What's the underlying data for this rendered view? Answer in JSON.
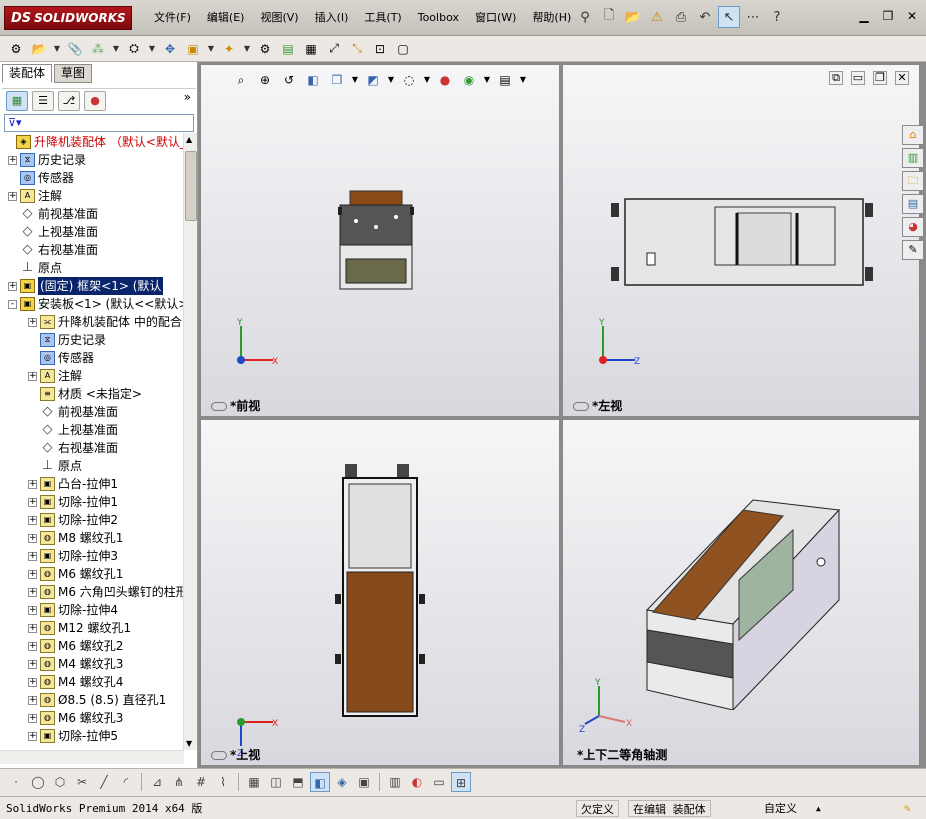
{
  "app": {
    "name": "SOLIDWORKS",
    "logo_prefix": "DS",
    "brand_color": "#a0141a"
  },
  "menu": [
    "文件(F)",
    "编辑(E)",
    "视图(V)",
    "插入(I)",
    "工具(T)",
    "Toolbox",
    "窗口(W)",
    "帮助(H)"
  ],
  "quick_tools": [
    "pin-icon",
    "new-doc-icon",
    "open-icon",
    "rebuild-warning-icon",
    "print-icon",
    "undo-icon",
    "select-icon",
    "options-icon",
    "help-icon"
  ],
  "window_controls": [
    "minimize-icon",
    "restore-icon",
    "close-icon"
  ],
  "toolbar2": [
    "edit-component-icon",
    "insert-component-icon",
    "mate-icon",
    "pattern-icon",
    "smart-fastener-icon",
    "move-component-icon",
    "show-hidden-icon",
    "assembly-features-icon",
    "reference-geometry-icon",
    "new-motion-study-icon",
    "bill-of-materials-icon",
    "exploded-view-icon",
    "explode-line-icon",
    "interference-icon",
    "instant3d-icon"
  ],
  "left_panel": {
    "tabs": [
      "装配体",
      "草图"
    ],
    "manager_icons": [
      "featuremanager-icon",
      "propertymanager-icon",
      "configurationmanager-icon",
      "appearance-icon"
    ],
    "tree": [
      {
        "label": "升降机装配体  （默认<默认_",
        "level": 0,
        "icon": "asm",
        "expand": "",
        "red": true
      },
      {
        "label": "历史记录",
        "level": 1,
        "icon": "hist",
        "expand": "+"
      },
      {
        "label": "传感器",
        "level": 1,
        "icon": "sensor",
        "expand": ""
      },
      {
        "label": "注解",
        "level": 1,
        "icon": "A",
        "expand": "+"
      },
      {
        "label": "前视基准面",
        "level": 1,
        "icon": "plane",
        "expand": ""
      },
      {
        "label": "上视基准面",
        "level": 1,
        "icon": "plane",
        "expand": ""
      },
      {
        "label": "右视基准面",
        "level": 1,
        "icon": "plane",
        "expand": ""
      },
      {
        "label": "原点",
        "level": 1,
        "icon": "origin",
        "expand": ""
      },
      {
        "label": "(固定) 框架<1> (默认",
        "level": 1,
        "icon": "part",
        "expand": "+",
        "selected": true
      },
      {
        "label": "安装板<1> (默认<<默认>_",
        "level": 1,
        "icon": "part",
        "expand": "-"
      },
      {
        "label": "升降机装配体 中的配合",
        "level": 2,
        "icon": "mate",
        "expand": "+"
      },
      {
        "label": "历史记录",
        "level": 2,
        "icon": "hist",
        "expand": ""
      },
      {
        "label": "传感器",
        "level": 2,
        "icon": "sensor",
        "expand": ""
      },
      {
        "label": "注解",
        "level": 2,
        "icon": "A",
        "expand": "+"
      },
      {
        "label": "材质 <未指定>",
        "level": 2,
        "icon": "mat",
        "expand": ""
      },
      {
        "label": "前视基准面",
        "level": 2,
        "icon": "plane",
        "expand": ""
      },
      {
        "label": "上视基准面",
        "level": 2,
        "icon": "plane",
        "expand": ""
      },
      {
        "label": "右视基准面",
        "level": 2,
        "icon": "plane",
        "expand": ""
      },
      {
        "label": "原点",
        "level": 2,
        "icon": "origin",
        "expand": ""
      },
      {
        "label": "凸台-拉伸1",
        "level": 2,
        "icon": "feat",
        "expand": "+"
      },
      {
        "label": "切除-拉伸1",
        "level": 2,
        "icon": "feat",
        "expand": "+"
      },
      {
        "label": "切除-拉伸2",
        "level": 2,
        "icon": "feat",
        "expand": "+"
      },
      {
        "label": "M8 螺纹孔1",
        "level": 2,
        "icon": "hole",
        "expand": "+"
      },
      {
        "label": "切除-拉伸3",
        "level": 2,
        "icon": "feat",
        "expand": "+"
      },
      {
        "label": "M6 螺纹孔1",
        "level": 2,
        "icon": "hole",
        "expand": "+"
      },
      {
        "label": "M6 六角凹头螺钉的柱形",
        "level": 2,
        "icon": "hole",
        "expand": "+"
      },
      {
        "label": "切除-拉伸4",
        "level": 2,
        "icon": "feat",
        "expand": "+"
      },
      {
        "label": "M12 螺纹孔1",
        "level": 2,
        "icon": "hole",
        "expand": "+"
      },
      {
        "label": "M6 螺纹孔2",
        "level": 2,
        "icon": "hole",
        "expand": "+"
      },
      {
        "label": "M4 螺纹孔3",
        "level": 2,
        "icon": "hole",
        "expand": "+"
      },
      {
        "label": "M4 螺纹孔4",
        "level": 2,
        "icon": "hole",
        "expand": "+"
      },
      {
        "label": "Ø8.5 (8.5) 直径孔1",
        "level": 2,
        "icon": "hole",
        "expand": "+"
      },
      {
        "label": "M6 螺纹孔3",
        "level": 2,
        "icon": "hole",
        "expand": "+"
      },
      {
        "label": "切除-拉伸5",
        "level": 2,
        "icon": "feat",
        "expand": "+"
      }
    ]
  },
  "viewports": [
    {
      "label": "*前视",
      "axes": [
        "Y",
        "X"
      ]
    },
    {
      "label": "*左视",
      "axes": [
        "Y",
        "Z"
      ]
    },
    {
      "label": "*上视",
      "axes": [
        "X",
        "Z"
      ]
    },
    {
      "label": "*上下二等角轴测",
      "axes": [
        "Y",
        "Z",
        "X"
      ]
    }
  ],
  "hud_icons": [
    "zoom-to-fit-icon",
    "zoom-area-icon",
    "previous-view-icon",
    "section-view-icon",
    "view-orientation-icon",
    "display-style-icon",
    "hide-show-icon",
    "edit-appearance-icon",
    "apply-scene-icon",
    "view-settings-icon"
  ],
  "viewport_controls": [
    "link-views-icon",
    "tile-icon",
    "restore-view-icon",
    "close-view-icon"
  ],
  "task_pane": [
    "home-icon",
    "design-library-icon",
    "file-explorer-icon",
    "view-palette-icon",
    "appearances-icon",
    "custom-properties-icon"
  ],
  "sketch_bar": [
    "point-icon",
    "circle-icon",
    "polygon-icon",
    "trim-icon",
    "line-icon",
    "arc-icon",
    "offset-icon",
    "mirror-icon",
    "grid-icon",
    "3d-sketch-icon",
    "box-icon",
    "cube-icon",
    "shaded-icon",
    "palette-icon",
    "layout-icon",
    "single-view-icon",
    "four-view-icon"
  ],
  "status": {
    "version": "SolidWorks Premium 2014 x64 版",
    "def": "欠定义",
    "editing": "在编辑 装配体",
    "custom": "自定义",
    "custom_arrow": "▲"
  }
}
